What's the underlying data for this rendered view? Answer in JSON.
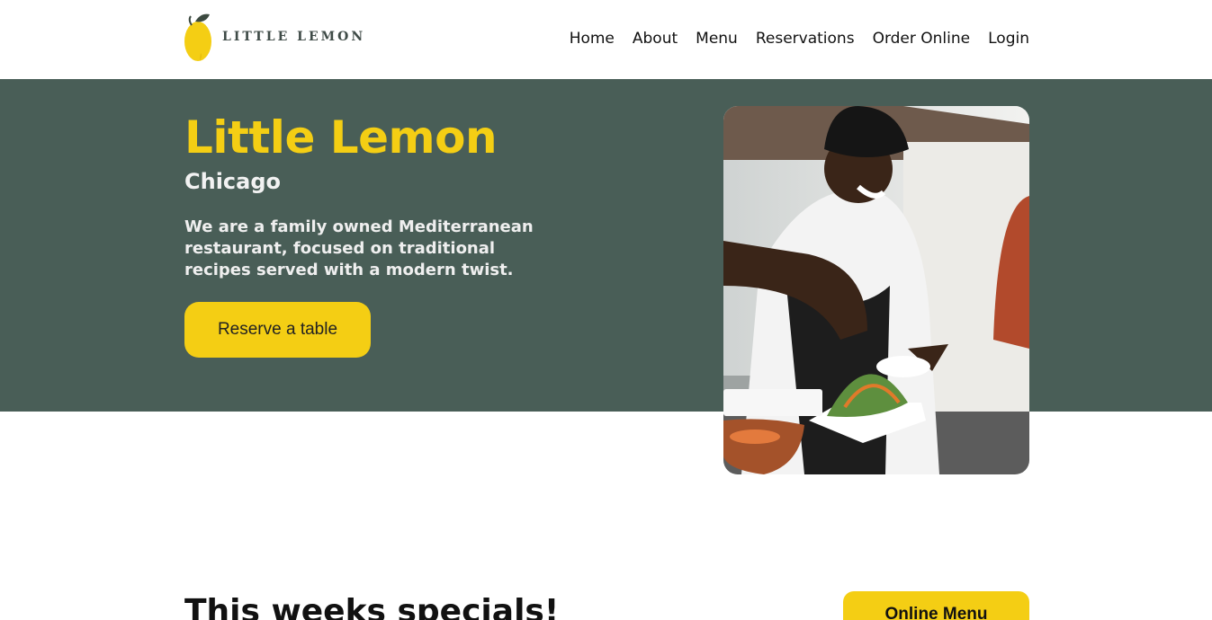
{
  "brand": {
    "name": "LITTLE LEMON"
  },
  "nav": {
    "items": [
      "Home",
      "About",
      "Menu",
      "Reservations",
      "Order Online",
      "Login"
    ]
  },
  "hero": {
    "title": "Little Lemon",
    "subtitle": "Chicago",
    "description": "We are a family owned Mediterranean restaurant, focused on traditional recipes served with a modern twist.",
    "cta": "Reserve a table"
  },
  "specials": {
    "title": "This weeks specials!",
    "menu_button": "Online Menu"
  },
  "colors": {
    "primary": "#495e57",
    "accent": "#f4ce14",
    "text": "#111111",
    "light": "#edefee"
  }
}
